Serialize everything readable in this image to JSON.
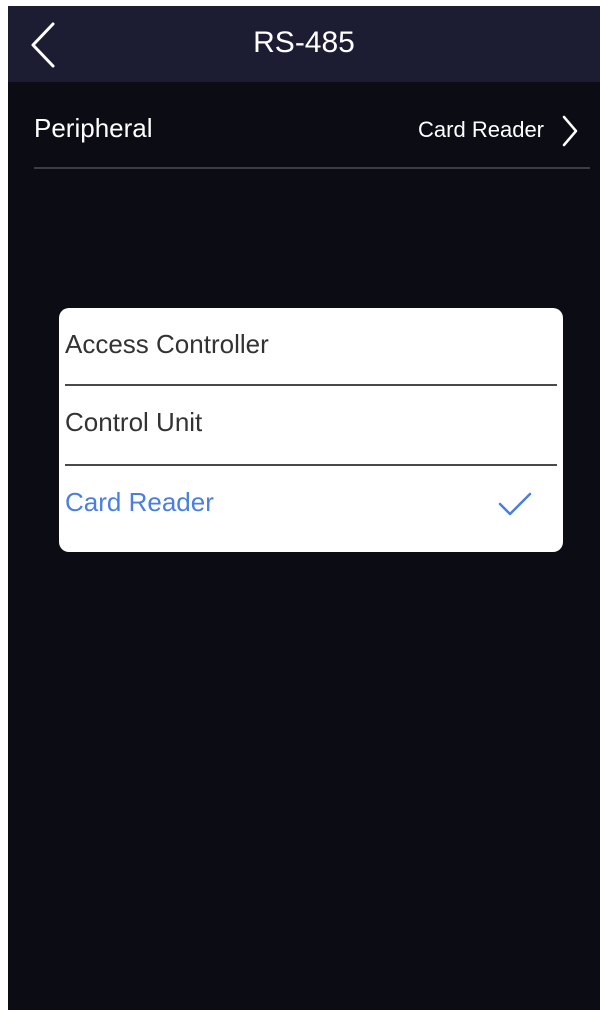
{
  "header": {
    "title": "RS-485",
    "back_icon": "chevron-left-icon"
  },
  "settings": {
    "peripheral_label": "Peripheral",
    "peripheral_value": "Card Reader",
    "chevron_icon": "chevron-right-icon"
  },
  "dialog": {
    "options": [
      {
        "label": "Access Controller",
        "selected": false
      },
      {
        "label": "Control Unit",
        "selected": false
      },
      {
        "label": "Card Reader",
        "selected": true
      }
    ],
    "check_icon": "checkmark-icon"
  },
  "colors": {
    "background": "#0b0c14",
    "header": "#1c1d33",
    "accent": "#4a7ee0"
  }
}
